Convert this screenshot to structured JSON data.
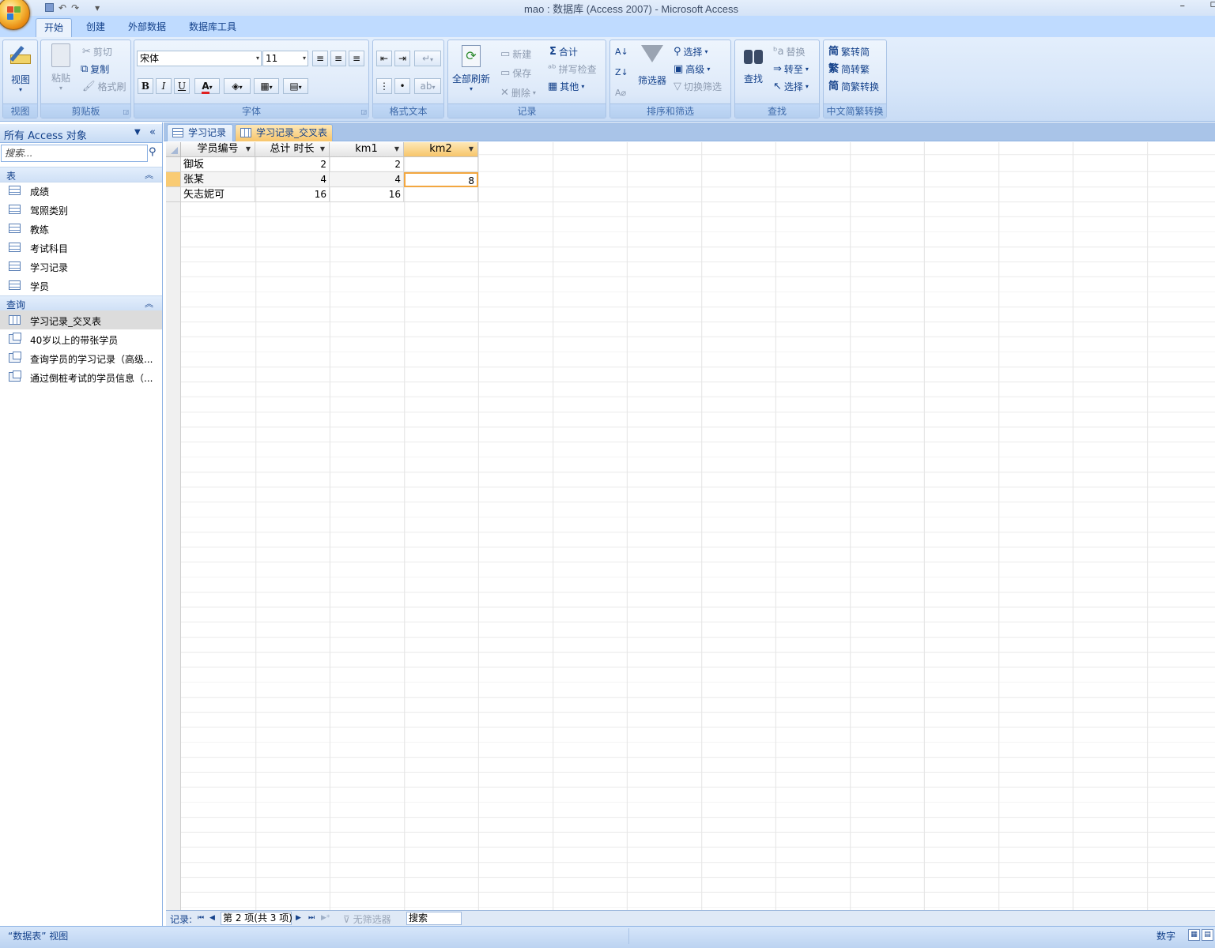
{
  "window": {
    "title": "mao : 数据库 (Access 2007) - Microsoft Access",
    "minimize": "–",
    "maximize": "▫"
  },
  "qat": {
    "undo": "↶",
    "redo": "↷",
    "customize": "▾"
  },
  "ribbon": {
    "tabs": [
      "开始",
      "创建",
      "外部数据",
      "数据库工具"
    ],
    "groups": {
      "view": {
        "label": "视图",
        "button": "视图"
      },
      "clipboard": {
        "label": "剪贴板",
        "paste": "粘贴",
        "cut": "剪切",
        "copy": "复制",
        "format_painter": "格式刷"
      },
      "font": {
        "label": "字体",
        "font_name": "宋体",
        "font_size": "11",
        "bold": "B",
        "italic": "I",
        "underline": "U"
      },
      "rich_text": {
        "label": "格式文本"
      },
      "records": {
        "label": "记录",
        "refresh_all": "全部刷新",
        "new": "新建",
        "save": "保存",
        "delete": "删除",
        "totals": "合计",
        "spelling": "拼写检查",
        "more": "其他"
      },
      "sort_filter": {
        "label": "排序和筛选",
        "filter": "筛选器",
        "selection": "选择",
        "advanced": "高级",
        "toggle_filter": "切换筛选"
      },
      "find": {
        "label": "查找",
        "find": "查找",
        "replace": "替换",
        "goto": "转至",
        "select": "选择"
      },
      "chinese_conversion": {
        "label": "中文简繁转换",
        "trad_to_simp": "繁转简",
        "simp_to_trad": "简转繁",
        "convert": "简繁转换"
      }
    }
  },
  "nav": {
    "title": "所有 Access 对象",
    "search_placeholder": "搜索...",
    "sections": [
      {
        "title": "表",
        "items": [
          "成绩",
          "驾照类别",
          "教练",
          "考试科目",
          "学习记录",
          "学员"
        ]
      },
      {
        "title": "查询",
        "items": [
          "学习记录_交叉表",
          "40岁以上的带张学员",
          "查询学员的学习记录（高级...",
          "通过倒桩考试的学员信息（..."
        ]
      }
    ],
    "selected_item": "学习记录_交叉表"
  },
  "doc_tabs": [
    {
      "label": "学习记录",
      "active": false
    },
    {
      "label": "学习记录_交叉表",
      "active": true
    }
  ],
  "datasheet": {
    "columns": [
      "学员编号",
      "总计 时长",
      "km1",
      "km2"
    ],
    "selected_column": "km2",
    "rows": [
      [
        "御坂",
        "2",
        "2",
        ""
      ],
      [
        "张某",
        "4",
        "4",
        "8"
      ],
      [
        "矢志妮可",
        "16",
        "16",
        ""
      ]
    ],
    "current_row": 2
  },
  "record_bar": {
    "label": "记录:",
    "first": "⏮",
    "prev": "◀",
    "position": "第 2 项(共 3 项)",
    "next": "▶",
    "last": "⏭",
    "new": "▶*",
    "filter": "无筛选器",
    "search": "搜索"
  },
  "status_bar": {
    "left": "“数据表” 视图",
    "right": "数字"
  },
  "colors": {
    "ribbon_bg": "#d7e6f9",
    "accent_orange": "#f7c56a",
    "border_blue": "#8db2e3",
    "text_blue": "#15428b"
  }
}
